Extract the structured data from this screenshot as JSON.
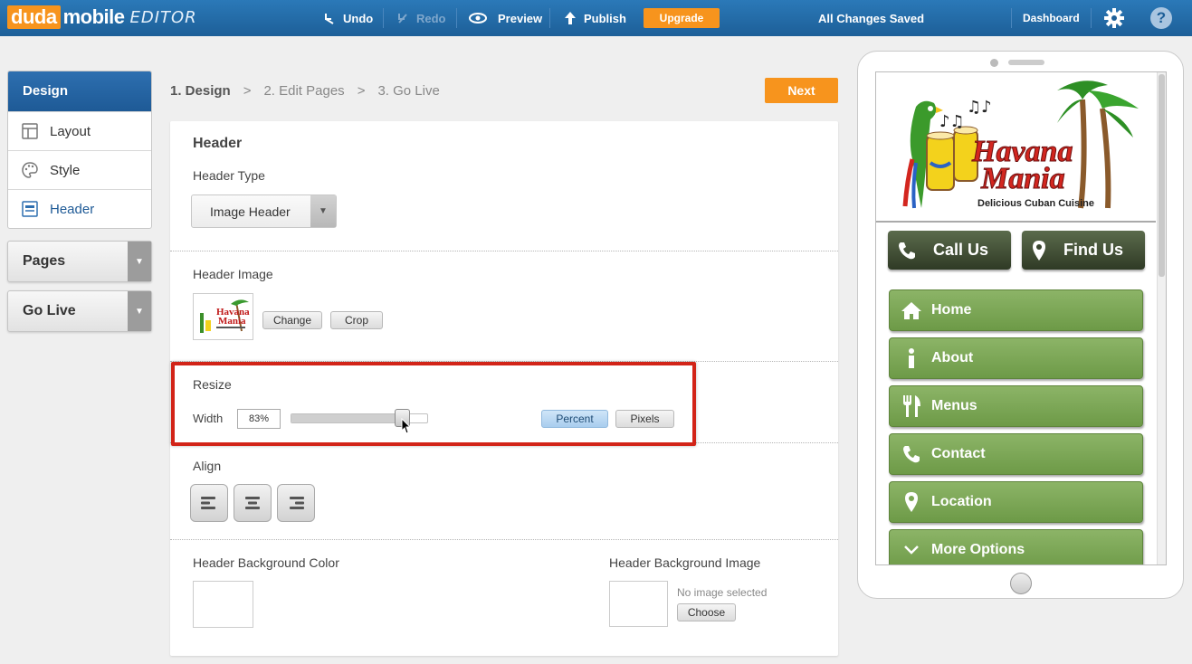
{
  "topbar": {
    "logo_duda": "duda",
    "logo_mobile": "mobile",
    "logo_editor": "EDITOR",
    "undo": "Undo",
    "redo": "Redo",
    "preview": "Preview",
    "publish": "Publish",
    "upgrade": "Upgrade",
    "status": "All Changes Saved",
    "dashboard": "Dashboard",
    "help": "?"
  },
  "sidebar": {
    "design": {
      "title": "Design",
      "items": [
        {
          "label": "Layout",
          "icon": "layout-icon"
        },
        {
          "label": "Style",
          "icon": "palette-icon"
        },
        {
          "label": "Header",
          "icon": "header-icon"
        }
      ]
    },
    "pages": "Pages",
    "golive": "Go Live"
  },
  "steps": {
    "step1": "1. Design",
    "sep1": ">",
    "step2": "2. Edit Pages",
    "sep2": ">",
    "step3": "3. Go Live",
    "next": "Next"
  },
  "editor": {
    "section_title": "Header",
    "header_type_label": "Header Type",
    "header_type_value": "Image Header",
    "header_image_label": "Header Image",
    "change": "Change",
    "crop": "Crop",
    "resize_label": "Resize",
    "width_label": "Width",
    "width_value": "83%",
    "width_fraction": 0.83,
    "percent": "Percent",
    "pixels": "Pixels",
    "align_label": "Align",
    "bg_color_label": "Header Background Color",
    "bg_image_label": "Header Background Image",
    "no_image": "No image selected",
    "choose": "Choose"
  },
  "preview": {
    "logo_line1": "Havana",
    "logo_line2": "Mania",
    "logo_tagline": "Delicious Cuban Cuisine",
    "call_us": "Call Us",
    "find_us": "Find Us",
    "menu": [
      {
        "label": "Home",
        "icon": "home-icon"
      },
      {
        "label": "About",
        "icon": "info-icon"
      },
      {
        "label": "Menus",
        "icon": "fork-knife-icon"
      },
      {
        "label": "Contact",
        "icon": "phone-icon"
      },
      {
        "label": "Location",
        "icon": "map-pin-icon"
      },
      {
        "label": "More Options",
        "icon": "chevron-down-icon"
      }
    ]
  },
  "colors": {
    "topbar": "#1d5f98",
    "accent": "#f7941d",
    "highlight": "#d22418",
    "menu_green": "#7aa653",
    "call_dark": "#3a4630"
  }
}
